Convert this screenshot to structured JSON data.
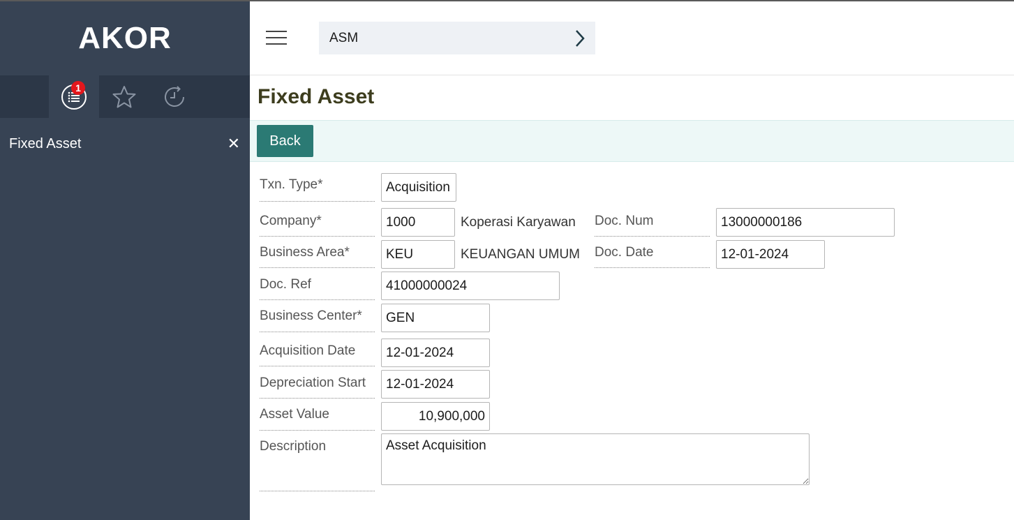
{
  "app": {
    "brand": "AKOR"
  },
  "sidebar": {
    "tabs": [
      {
        "icon": "list-icon",
        "badge": "1"
      },
      {
        "icon": "star-icon"
      },
      {
        "icon": "history-icon"
      }
    ],
    "items": [
      {
        "label": "Fixed Asset",
        "close": "✕"
      }
    ]
  },
  "topbar": {
    "breadcrumb": "ASM",
    "chevron": "›"
  },
  "page": {
    "title": "Fixed Asset",
    "back_label": "Back"
  },
  "form": {
    "txn_type": {
      "label": "Txn. Type*",
      "value": "Acquisition"
    },
    "company": {
      "label": "Company*",
      "value": "1000",
      "desc": "Koperasi Karyawan"
    },
    "doc_num": {
      "label": "Doc. Num",
      "value": "13000000186"
    },
    "business_area": {
      "label": "Business Area*",
      "value": "KEU",
      "desc": "KEUANGAN UMUM"
    },
    "doc_date": {
      "label": "Doc. Date",
      "value": "12-01-2024"
    },
    "doc_ref": {
      "label": "Doc. Ref",
      "value": "41000000024"
    },
    "business_center": {
      "label": "Business Center*",
      "value": "GEN"
    },
    "acquisition_date": {
      "label": "Acquisition Date",
      "value": "12-01-2024"
    },
    "depreciation_start": {
      "label": "Depreciation Start",
      "value": "12-01-2024"
    },
    "asset_value": {
      "label": "Asset Value",
      "value": "10,900,000"
    },
    "description": {
      "label": "Description",
      "value": "Asset Acquisition"
    }
  },
  "colors": {
    "sidebar": "#374354",
    "tabbar": "#2c3747",
    "accent": "#2b7a74",
    "badge": "#e3171c",
    "title": "#3d3d1e"
  }
}
